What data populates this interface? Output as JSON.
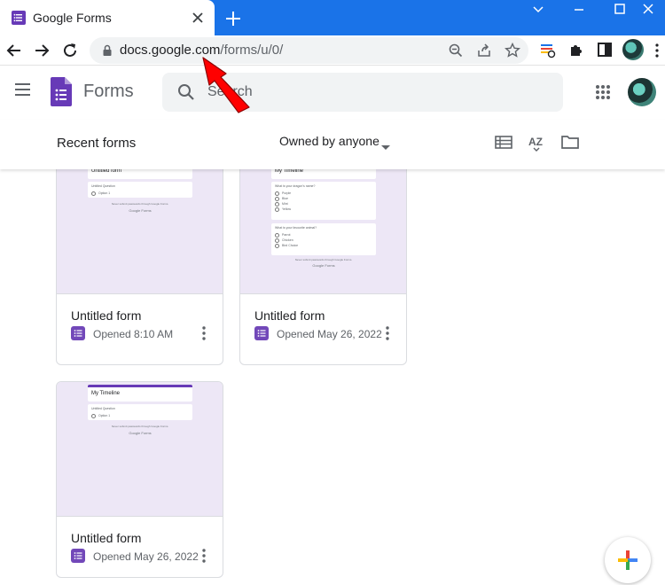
{
  "browser": {
    "tab_title": "Google Forms",
    "url_host": "docs.google.com",
    "url_path": "/forms/u/0/"
  },
  "app": {
    "name": "Forms",
    "search_placeholder": "Search",
    "section_title": "Recent forms",
    "owner_filter": "Owned by anyone"
  },
  "cards": [
    {
      "title": "Untitled form",
      "opened": "Opened 8:10 AM",
      "preview_title": "Untitled form",
      "preview_questions": [
        {
          "q": "Untitled Question",
          "options": [
            "Option 1"
          ]
        }
      ]
    },
    {
      "title": "Untitled form",
      "opened": "Opened May 26, 2022",
      "preview_title": "My Timeline",
      "preview_questions": [
        {
          "q": "What is your dragon's name?",
          "options": [
            "Purple",
            "Blue",
            "Mint",
            "Yellow"
          ]
        },
        {
          "q": "What is your favourite animal?",
          "options": [
            "Parrot",
            "Chicken",
            "Bird Choice"
          ]
        }
      ]
    },
    {
      "title": "Untitled form",
      "opened": "Opened May 26, 2022",
      "preview_title": "My Timeline",
      "preview_questions": [
        {
          "q": "Untitled Question",
          "options": [
            "Option 1"
          ]
        }
      ]
    }
  ],
  "preview_footer": "Never submit passwords through Google Forms.",
  "preview_brand": "Google Forms",
  "colors": {
    "forms_purple": "#673ab7",
    "chrome_blue": "#1a73e8",
    "thumb_bg": "#ede7f6",
    "annotation_red": "#ff0000"
  }
}
